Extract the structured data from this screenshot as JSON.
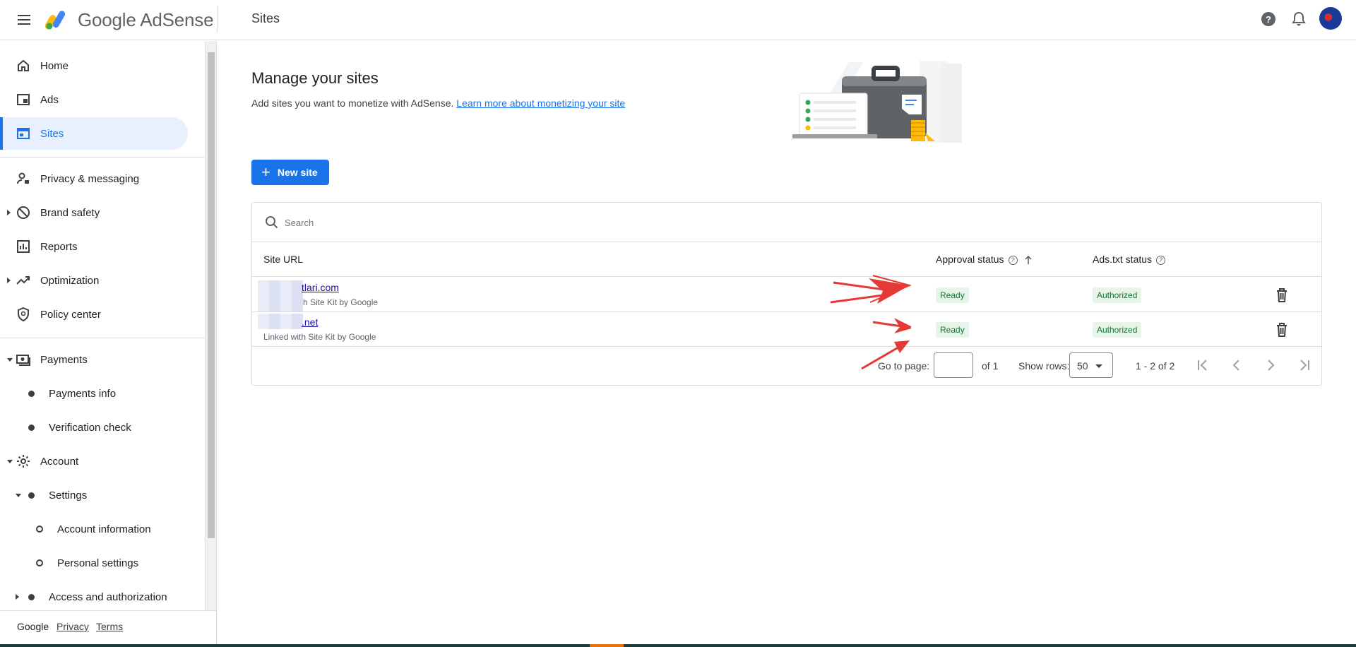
{
  "app": {
    "brand_google": "Google",
    "brand_product": "AdSense",
    "page_title": "Sites",
    "icons": [
      "menu-icon",
      "help-icon",
      "bell-icon"
    ]
  },
  "sidebar": {
    "home": "Home",
    "ads": "Ads",
    "sites": "Sites",
    "privacy": "Privacy & messaging",
    "brand_safety": "Brand safety",
    "reports": "Reports",
    "optimization": "Optimization",
    "policy_center": "Policy center",
    "payments": "Payments",
    "payments_info": "Payments info",
    "verification_check": "Verification check",
    "account": "Account",
    "settings": "Settings",
    "account_information": "Account information",
    "personal_settings": "Personal settings",
    "access_authorization": "Access and authorization"
  },
  "footer": {
    "google": "Google",
    "privacy": "Privacy",
    "terms": "Terms"
  },
  "main": {
    "heading": "Manage your sites",
    "subtext": "Add sites you want to monetize with AdSense.",
    "learn_more": "Learn more about monetizing your site",
    "new_site": "New site",
    "search_placeholder": "Search",
    "columns": {
      "site_url": "Site URL",
      "approval_status": "Approval status",
      "ads_txt_status": "Ads.txt status"
    },
    "rows": [
      {
        "url": "tlari.com",
        "linked": "h Site Kit by Google",
        "approval": "Ready",
        "ads_txt": "Authorized"
      },
      {
        "url": ".net",
        "linked": "Linked with Site Kit by Google",
        "approval": "Ready",
        "ads_txt": "Authorized"
      }
    ],
    "pager": {
      "go_to_page": "Go to page:",
      "of": "of 1",
      "show_rows": "Show rows:",
      "rows_value": "50",
      "range": "1 - 2 of 2"
    }
  },
  "colors": {
    "accent": "#1a73e8",
    "status_bg": "#e6f4ea",
    "status_text": "#137333",
    "annotation_arrow": "#e53935"
  }
}
